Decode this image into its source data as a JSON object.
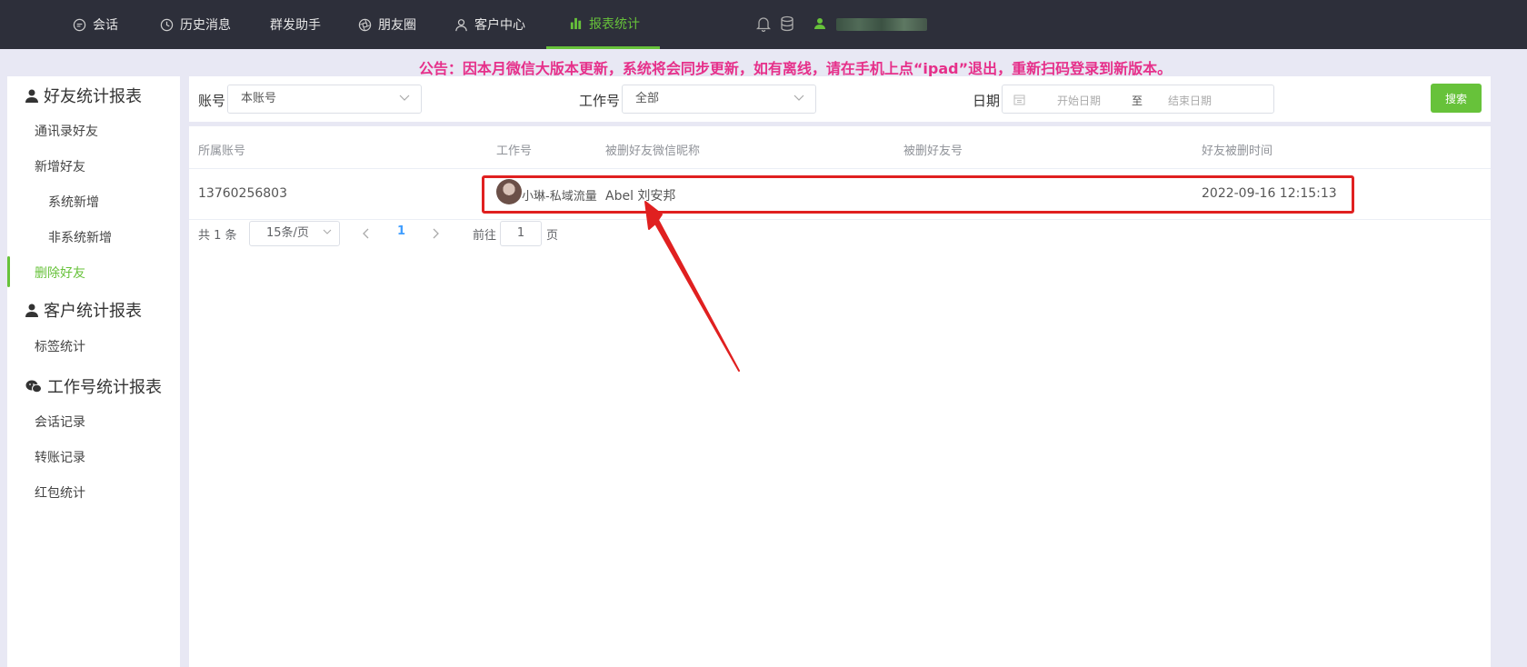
{
  "nav": {
    "items": [
      {
        "label": "会话",
        "icon": "chat-bubble-icon"
      },
      {
        "label": "历史消息",
        "icon": "clock-icon"
      },
      {
        "label": "群发助手",
        "icon": ""
      },
      {
        "label": "朋友圈",
        "icon": "aperture-icon"
      },
      {
        "label": "客户中心",
        "icon": "user-icon"
      },
      {
        "label": "报表统计",
        "icon": "bar-chart-icon"
      }
    ],
    "active_index": 5,
    "accent_color": "#67c23a"
  },
  "notice": "公告：因本月微信大版本更新，系统将会同步更新，如有离线，请在手机上点“ipad”退出，重新扫码登录到新版本。",
  "sidebar": {
    "groups": [
      {
        "title": "好友统计报表",
        "icon": "user-icon",
        "items": [
          "通讯录好友",
          "新增好友",
          "系统新增",
          "非系统新增",
          "删除好友"
        ]
      },
      {
        "title": "客户统计报表",
        "icon": "user-icon",
        "items": [
          "标签统计"
        ]
      },
      {
        "title": "工作号统计报表",
        "icon": "wechat-icon",
        "items": [
          "会话记录",
          "转账记录",
          "红包统计"
        ]
      }
    ],
    "active_item": "删除好友"
  },
  "filters": {
    "account_label": "账号",
    "account_value": "本账号",
    "work_label": "工作号",
    "work_value": "全部",
    "date_label": "日期",
    "date_start_placeholder": "开始日期",
    "date_sep": "至",
    "date_end_placeholder": "结束日期",
    "search_label": "搜索"
  },
  "table": {
    "columns": [
      "所属账号",
      "工作号",
      "被删好友微信昵称",
      "被删好友号",
      "好友被删时间"
    ],
    "rows": [
      {
        "account": "13760256803",
        "work": "小琳-私域流量",
        "nickname": "Abel 刘安邦",
        "friend_id": "",
        "time": "2022-09-16 12:15:13"
      }
    ]
  },
  "pagination": {
    "total": "共 1 条",
    "page_size": "15条/页",
    "current_page": "1",
    "goto_label": "前往",
    "goto_value": "1",
    "page_suffix": "页"
  }
}
